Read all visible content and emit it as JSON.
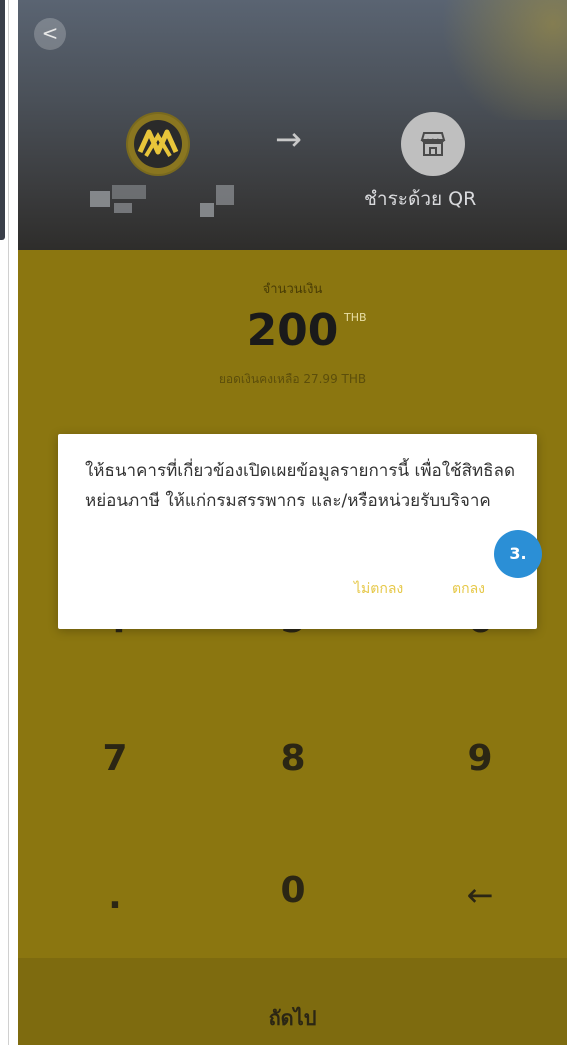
{
  "header": {
    "back_glyph": "<",
    "arrow_glyph": "→",
    "pay_method_label": "ชำระด้วย QR"
  },
  "amount": {
    "label": "จำนวนเงิน",
    "value": "200",
    "currency": "THB",
    "balance": "ยอดเงินคงเหลือ 27.99 THB"
  },
  "keypad": {
    "keys_visible": [
      "4",
      "5",
      "6",
      "7",
      "8",
      "9",
      ".",
      "0",
      "←"
    ]
  },
  "footer": {
    "next_label": "ถัดไป"
  },
  "dialog": {
    "message": "ให้ธนาคารที่เกี่ยวข้องเปิดเผยข้อมูลรายการนี้ เพื่อใช้สิทธิลดหย่อนภาษี ให้แก่กรมสรรพากร และ/หรือหน่วยรับบริจาค",
    "cancel_label": "ไม่ตกลง",
    "ok_label": "ตกลง"
  },
  "annotation": {
    "step": "3."
  },
  "colors": {
    "accent_yellow": "#e6c848",
    "body_gold": "#8b7610",
    "badge_blue": "#2b8fd6"
  },
  "icons": [
    "back-icon",
    "bank-logo-icon",
    "arrow-right-icon",
    "shop-icon",
    "backspace-icon"
  ]
}
